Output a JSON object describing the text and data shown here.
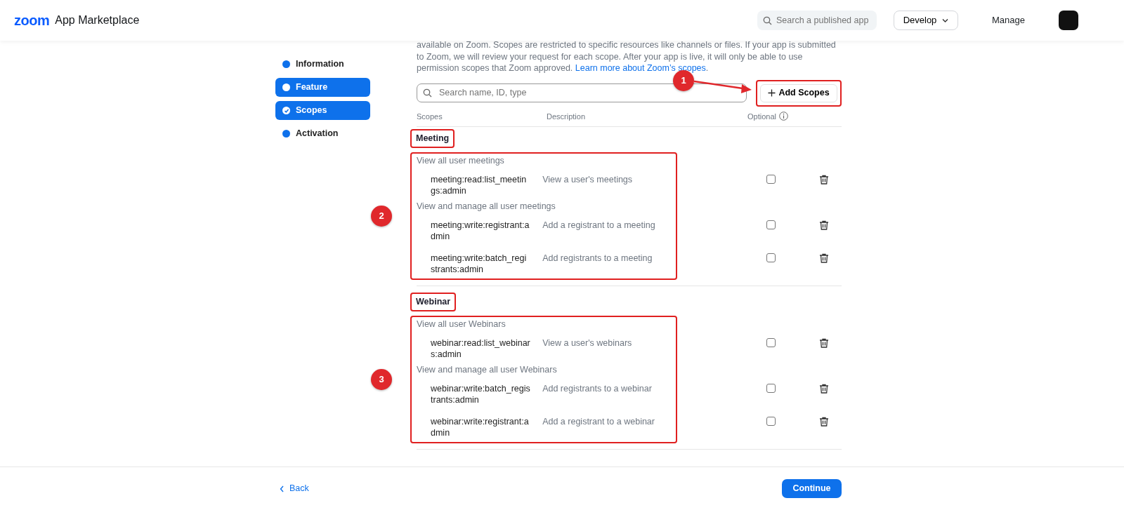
{
  "header": {
    "logo": "zoom",
    "title": "App Marketplace",
    "search": {
      "placeholder": "Search a published app"
    },
    "develop": "Develop",
    "manage": "Manage"
  },
  "sidebar": {
    "items": [
      {
        "label": "Information",
        "selected": false,
        "completed": false
      },
      {
        "label": "Feature",
        "selected": true,
        "completed": false
      },
      {
        "label": "Scopes",
        "selected": true,
        "completed": true
      },
      {
        "label": "Activation",
        "selected": false,
        "completed": false
      }
    ]
  },
  "intro": {
    "text": "available on Zoom. Scopes are restricted to specific resources like channels or files. If your app is submitted to Zoom, we will review your request for each scope. After your app is live, it will only be able to use permission scopes that Zoom approved.",
    "link": "Learn more about Zoom’s scopes",
    "end": "."
  },
  "scope_search": {
    "placeholder": "Search name, ID, type"
  },
  "add_scopes": {
    "label": "Add Scopes",
    "annotation": "1"
  },
  "columns": [
    "Scopes",
    "Description",
    "Optional"
  ],
  "groups": [
    {
      "title": "Meeting",
      "annotation": "2",
      "sections": [
        {
          "title": "View all user meetings",
          "scopes": [
            {
              "name": "meeting:read:list_meetings:admin",
              "description": "View a user's meetings",
              "optional": false
            }
          ]
        },
        {
          "title": "View and manage all user meetings",
          "scopes": [
            {
              "name": "meeting:write:registrant:admin",
              "description": "Add a registrant to a meeting",
              "optional": false
            },
            {
              "name": "meeting:write:batch_registrants:admin",
              "description": "Add registrants to a meeting",
              "optional": false
            }
          ]
        }
      ]
    },
    {
      "title": "Webinar",
      "annotation": "3",
      "sections": [
        {
          "title": "View all user Webinars",
          "scopes": [
            {
              "name": "webinar:read:list_webinars:admin",
              "description": "View a user's webinars",
              "optional": false
            }
          ]
        },
        {
          "title": "View and manage all user Webinars",
          "scopes": [
            {
              "name": "webinar:write:batch_registrants:admin",
              "description": "Add registrants to a webinar",
              "optional": false
            },
            {
              "name": "webinar:write:registrant:admin",
              "description": "Add a registrant to a webinar",
              "optional": false
            }
          ]
        }
      ]
    }
  ],
  "footer": {
    "back": "Back",
    "continue": "Continue"
  }
}
